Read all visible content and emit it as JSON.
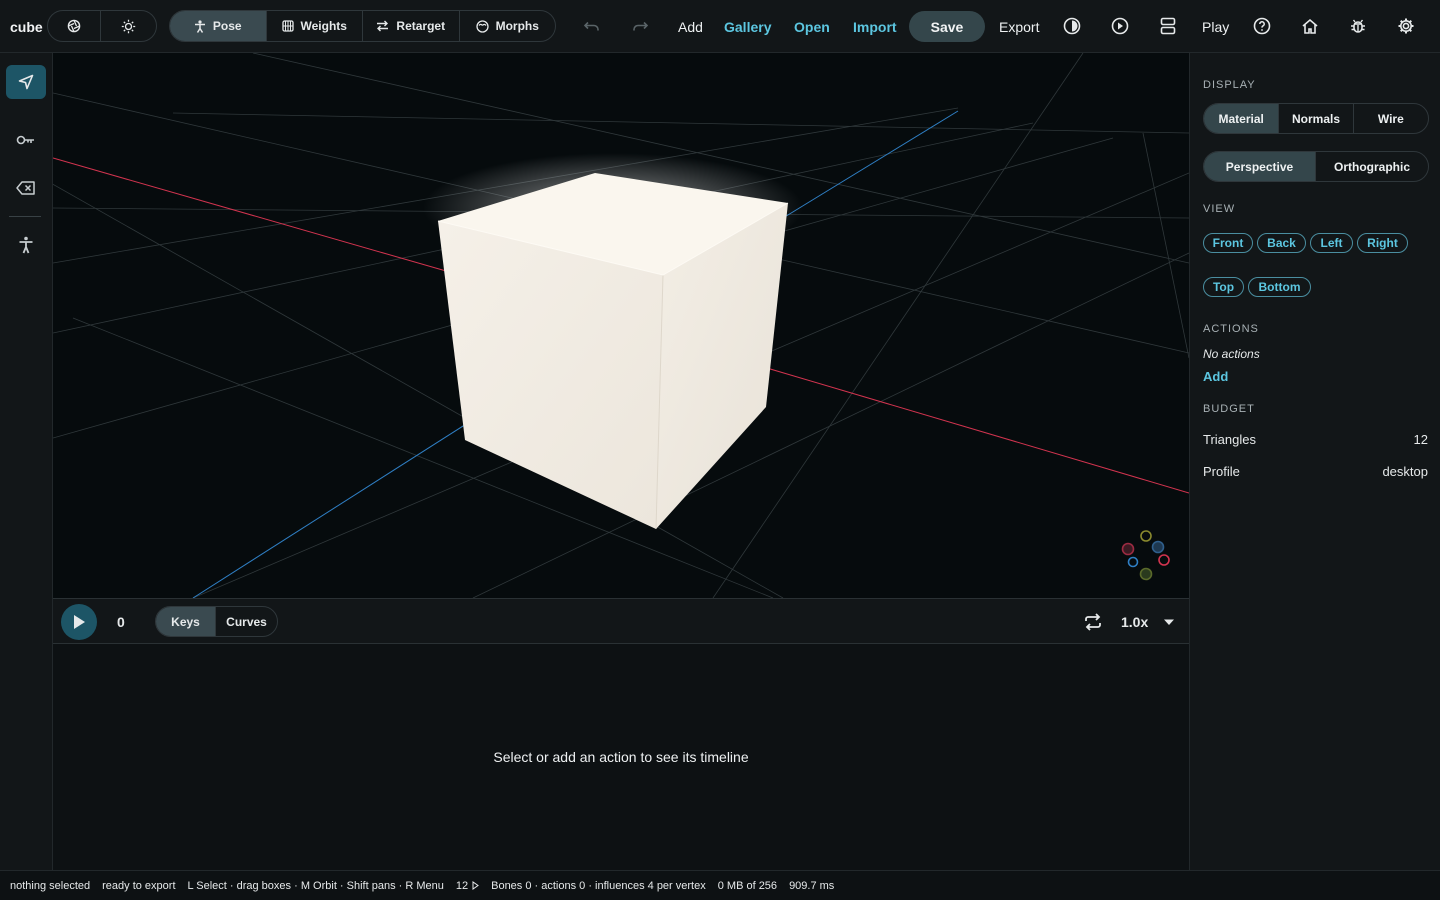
{
  "app": {
    "title": "cube"
  },
  "topbar": {
    "modes": [
      {
        "label": "Pose",
        "icon": "figure-icon",
        "active": true
      },
      {
        "label": "Weights",
        "icon": "grid-icon",
        "active": false
      },
      {
        "label": "Retarget",
        "icon": "swap-icon",
        "active": false
      },
      {
        "label": "Morphs",
        "icon": "face-icon",
        "active": false
      }
    ],
    "actions": {
      "add": "Add",
      "gallery": "Gallery",
      "open": "Open",
      "import": "Import",
      "save": "Save",
      "export": "Export",
      "play": "Play"
    }
  },
  "timeline": {
    "frame": "0",
    "modes": [
      {
        "label": "Keys",
        "active": true
      },
      {
        "label": "Curves",
        "active": false
      }
    ],
    "speed": "1.0x",
    "empty_message": "Select or add an action to see its timeline"
  },
  "panel": {
    "display_heading": "DISPLAY",
    "shading": [
      {
        "label": "Material",
        "active": true
      },
      {
        "label": "Normals",
        "active": false
      },
      {
        "label": "Wire",
        "active": false
      }
    ],
    "projection": [
      {
        "label": "Perspective",
        "active": true
      },
      {
        "label": "Orthographic",
        "active": false
      }
    ],
    "view_heading": "VIEW",
    "views": [
      "Front",
      "Back",
      "Left",
      "Right",
      "Top",
      "Bottom"
    ],
    "actions_heading": "ACTIONS",
    "no_actions": "No actions",
    "add_action": "Add",
    "budget_heading": "BUDGET",
    "budget": [
      {
        "label": "Triangles",
        "value": "12"
      },
      {
        "label": "Profile",
        "value": "desktop"
      }
    ]
  },
  "status": {
    "selection": "nothing selected",
    "export_state": "ready to export",
    "hints": "L Select · drag boxes · M Orbit · Shift pans · R Menu",
    "tri_count": "12",
    "rig": "Bones 0 · actions 0 · influences 4 per vertex",
    "memory": "0 MB of 256",
    "timing": "909.7 ms"
  },
  "colors": {
    "accent": "#5cc6e0",
    "active_tool": "#1d5566",
    "axis_x": "#d2344f",
    "axis_z": "#2f7fc4",
    "cube": "#f4efe6"
  }
}
